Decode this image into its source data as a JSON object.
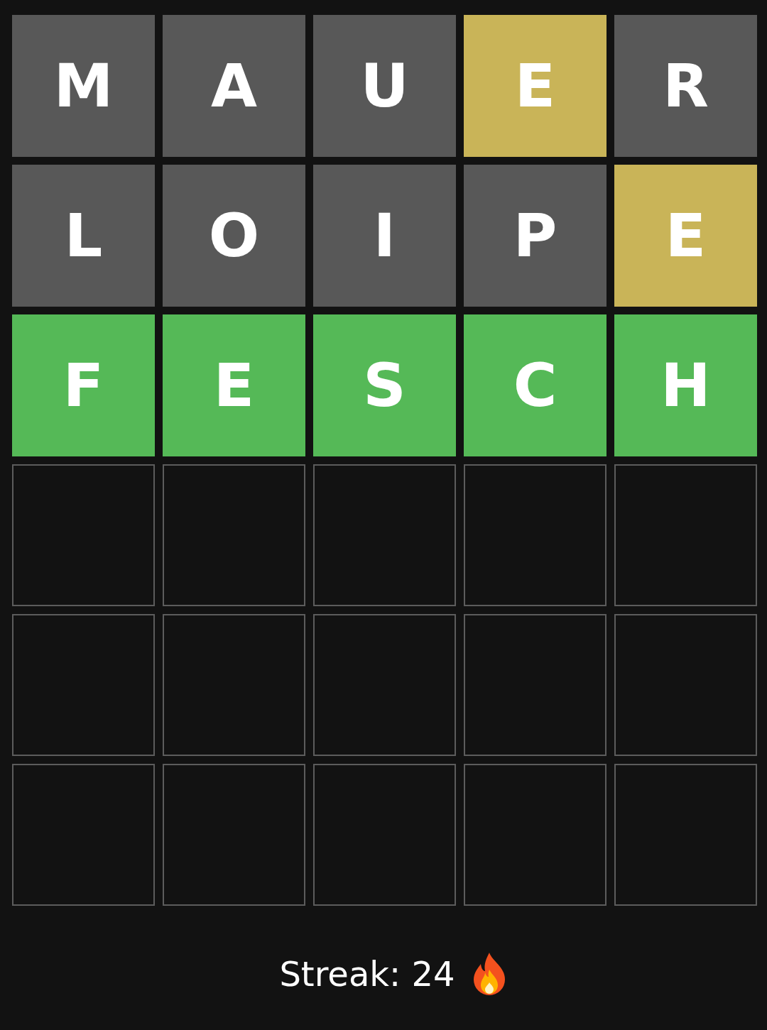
{
  "rows": [
    {
      "tiles": [
        {
          "letter": "M",
          "kind": "absent"
        },
        {
          "letter": "A",
          "kind": "absent"
        },
        {
          "letter": "U",
          "kind": "absent"
        },
        {
          "letter": "E",
          "kind": "present"
        },
        {
          "letter": "R",
          "kind": "absent"
        }
      ]
    },
    {
      "tiles": [
        {
          "letter": "L",
          "kind": "absent"
        },
        {
          "letter": "O",
          "kind": "absent"
        },
        {
          "letter": "I",
          "kind": "absent"
        },
        {
          "letter": "P",
          "kind": "absent"
        },
        {
          "letter": "E",
          "kind": "present"
        }
      ]
    },
    {
      "tiles": [
        {
          "letter": "F",
          "kind": "correct"
        },
        {
          "letter": "E",
          "kind": "correct"
        },
        {
          "letter": "S",
          "kind": "correct"
        },
        {
          "letter": "C",
          "kind": "correct"
        },
        {
          "letter": "H",
          "kind": "correct"
        }
      ]
    },
    {
      "tiles": [
        {
          "kind": "empty"
        },
        {
          "kind": "empty"
        },
        {
          "kind": "empty"
        },
        {
          "kind": "empty"
        },
        {
          "kind": "empty"
        }
      ]
    },
    {
      "tiles": [
        {
          "kind": "empty"
        },
        {
          "kind": "empty"
        },
        {
          "kind": "empty"
        },
        {
          "kind": "empty"
        },
        {
          "kind": "empty"
        }
      ]
    },
    {
      "tiles": [
        {
          "kind": "empty"
        },
        {
          "kind": "empty"
        },
        {
          "kind": "empty"
        },
        {
          "kind": "empty"
        },
        {
          "kind": "empty"
        }
      ]
    }
  ],
  "streak": "Streak: 24"
}
